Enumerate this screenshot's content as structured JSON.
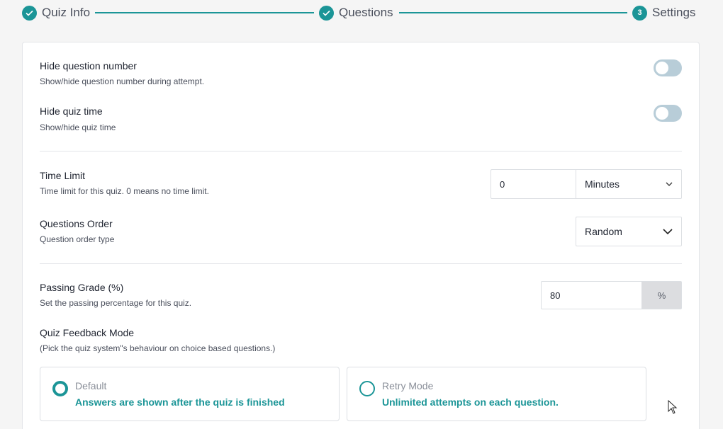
{
  "stepper": {
    "steps": [
      {
        "label": "Quiz Info",
        "state": "done"
      },
      {
        "label": "Questions",
        "state": "done"
      },
      {
        "label": "Settings",
        "state": "current",
        "number": "3"
      }
    ],
    "accent": "#1b9597"
  },
  "settings": {
    "hide_question_number": {
      "title": "Hide question number",
      "desc": "Show/hide question number during attempt.",
      "enabled": false
    },
    "hide_quiz_time": {
      "title": "Hide quiz time",
      "desc": "Show/hide quiz time",
      "enabled": false
    },
    "time_limit": {
      "title": "Time Limit",
      "desc": "Time limit for this quiz. 0 means no time limit.",
      "value": "0",
      "unit": "Minutes"
    },
    "questions_order": {
      "title": "Questions Order",
      "desc": "Question order type",
      "value": "Random"
    },
    "passing_grade": {
      "title": "Passing Grade (%)",
      "desc": "Set the passing percentage for this quiz.",
      "value": "80",
      "suffix": "%"
    },
    "feedback_mode": {
      "title": "Quiz Feedback Mode",
      "desc": "(Pick the quiz system\"s behaviour on choice based questions.)",
      "options": [
        {
          "title": "Default",
          "desc": "Answers are shown after the quiz is finished",
          "selected": true
        },
        {
          "title": "Retry Mode",
          "desc": "Unlimited attempts on each question.",
          "selected": false
        }
      ]
    }
  }
}
